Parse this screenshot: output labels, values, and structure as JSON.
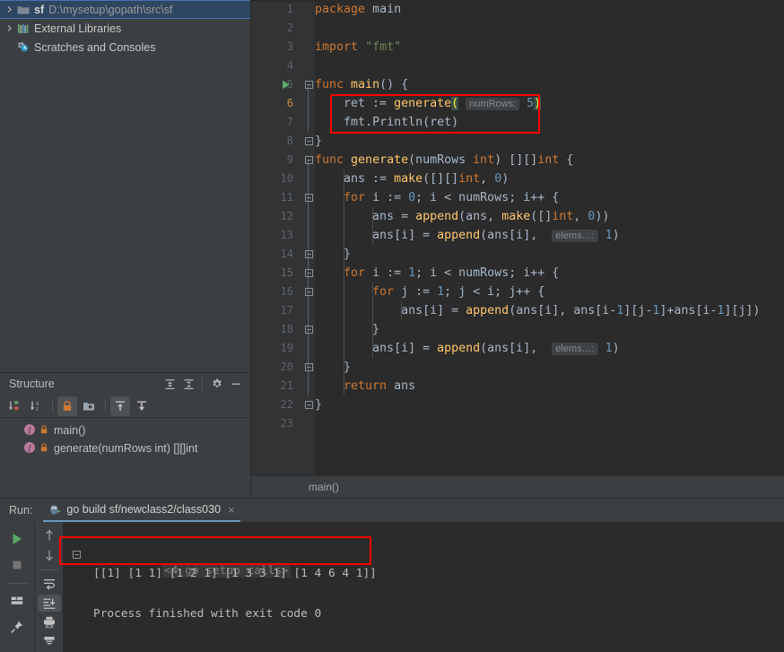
{
  "project_tree": {
    "items": [
      {
        "id": "sf-root",
        "name_bold": "sf",
        "path": "D:\\mysetup\\gopath\\src\\sf",
        "icon": "folder-icon",
        "expandable": true,
        "selected": true
      },
      {
        "id": "external-libraries",
        "name_bold": "",
        "label": "External Libraries",
        "icon": "library-icon",
        "expandable": true,
        "selected": false
      },
      {
        "id": "scratches-consoles",
        "name_bold": "",
        "label": "Scratches and Consoles",
        "icon": "scratches-icon",
        "expandable": false,
        "selected": false
      }
    ]
  },
  "structure": {
    "title": "Structure",
    "header_buttons": [
      {
        "id": "expand-all",
        "icon": "expand-all-icon"
      },
      {
        "id": "collapse-all",
        "icon": "collapse-all-icon"
      },
      {
        "id": "settings",
        "icon": "gear-icon"
      },
      {
        "id": "hide",
        "icon": "minimize-icon"
      }
    ],
    "toolbar_buttons": [
      {
        "id": "sort-by-visibility",
        "icon": "sort-by-visibility-icon",
        "active": false
      },
      {
        "id": "sort-alphabetically",
        "icon": "sort-alphabetically-icon",
        "active": false
      },
      {
        "id": "show-non-public",
        "icon": "lock-icon",
        "active": true
      },
      {
        "id": "group-by-file",
        "icon": "file-group-icon",
        "active": false
      },
      {
        "id": "expand-node",
        "icon": "expand-node-icon",
        "active": true
      },
      {
        "id": "collapse-node",
        "icon": "collapse-node-icon",
        "active": false
      }
    ],
    "items": [
      {
        "id": "struct-main",
        "label": "main()",
        "kind": "function",
        "visibility": "private"
      },
      {
        "id": "struct-generate",
        "label": "generate(numRows int) [][]int",
        "kind": "function",
        "visibility": "private"
      }
    ]
  },
  "editor": {
    "breadcrumb": "main()",
    "current_line": 6,
    "lines": [
      {
        "n": 1,
        "indent": 0
      },
      {
        "n": 2,
        "indent": 0
      },
      {
        "n": 3,
        "indent": 0
      },
      {
        "n": 4,
        "indent": 0
      },
      {
        "n": 5,
        "indent": 0
      },
      {
        "n": 6,
        "indent": 1
      },
      {
        "n": 7,
        "indent": 1
      },
      {
        "n": 8,
        "indent": 0
      },
      {
        "n": 9,
        "indent": 0
      },
      {
        "n": 10,
        "indent": 1
      },
      {
        "n": 11,
        "indent": 1
      },
      {
        "n": 12,
        "indent": 2
      },
      {
        "n": 13,
        "indent": 2
      },
      {
        "n": 14,
        "indent": 1
      },
      {
        "n": 15,
        "indent": 1
      },
      {
        "n": 16,
        "indent": 2
      },
      {
        "n": 17,
        "indent": 3
      },
      {
        "n": 18,
        "indent": 2
      },
      {
        "n": 19,
        "indent": 2
      },
      {
        "n": 20,
        "indent": 1
      },
      {
        "n": 21,
        "indent": 1
      },
      {
        "n": 22,
        "indent": 0
      },
      {
        "n": 23,
        "indent": 0
      }
    ],
    "code_text": {
      "l1": "package main",
      "l3": "import \"fmt\"",
      "l5": "func main() {",
      "l6": "    ret := generate( numRows: 5)",
      "l7": "    fmt.Println(ret)",
      "l8": "}",
      "l9": "func generate(numRows int) [][]int {",
      "l10": "    ans := make([][]int, 0)",
      "l11": "    for i := 0; i < numRows; i++ {",
      "l12": "        ans = append(ans, make([]int, 0))",
      "l13": "        ans[i] = append(ans[i],  elems…: 1)",
      "l14": "    }",
      "l15": "    for i := 1; i < numRows; i++ {",
      "l16": "        for j := 1; j < i; j++ {",
      "l17": "            ans[i] = append(ans[i], ans[i-1][j-1]+ans[i-1][j])",
      "l18": "        }",
      "l19": "        ans[i] = append(ans[i],  elems…: 1)",
      "l20": "    }",
      "l21": "    return ans",
      "l22": "}"
    },
    "inlay_hints": {
      "num_rows": "numRows:",
      "elems": "elems…:"
    },
    "gutter_run_marker_line": 5
  },
  "run_panel": {
    "run_label": "Run:",
    "tab": {
      "title": "go build sf/newclass2/class030",
      "icon": "go-gopher-icon",
      "close": "×"
    },
    "sidebar_left_buttons": [
      {
        "id": "rerun",
        "icon": "play-icon",
        "color": "#59a869"
      },
      {
        "id": "stop",
        "icon": "stop-icon",
        "color": "#7a7a7a"
      },
      {
        "id": "layout",
        "icon": "layout-icon"
      },
      {
        "id": "pin",
        "icon": "pin-icon"
      }
    ],
    "sidebar_right_buttons": [
      {
        "id": "prev-occurrence",
        "icon": "arrow-up-icon"
      },
      {
        "id": "next-occurrence",
        "icon": "arrow-down-icon"
      },
      {
        "id": "soft-wrap",
        "icon": "soft-wrap-icon"
      },
      {
        "id": "scroll-to-end",
        "icon": "scroll-to-end-icon",
        "active": true
      },
      {
        "id": "print",
        "icon": "print-icon"
      },
      {
        "id": "clear-all",
        "icon": "clear-all-icon"
      }
    ],
    "console_lines": [
      {
        "id": "setup-calls",
        "text": "<4 go setup calls>",
        "style": "fold"
      },
      {
        "id": "output",
        "text": "[[1] [1 1] [1 2 1] [1 3 3 1] [1 4 6 4 1]]",
        "style": "normal"
      },
      {
        "id": "exit",
        "text": "Process finished with exit code 0",
        "style": "normal"
      }
    ]
  },
  "annotations": [
    {
      "id": "code-highlight-box",
      "color": "#ff0000",
      "target": "lines 6-7"
    },
    {
      "id": "output-highlight-box",
      "color": "#ff0000",
      "target": "program output"
    }
  ],
  "colors": {
    "background": "#3c3f41",
    "editor_bg": "#2b2b2b",
    "gutter_bg": "#313335",
    "selection": "#2f4661",
    "accent_blue": "#6897bb",
    "keyword_orange": "#cc7832",
    "function_yellow": "#ffc66d",
    "string_green": "#6a8759",
    "text_default": "#a9b7c6",
    "annotation_red": "#ff0000"
  }
}
